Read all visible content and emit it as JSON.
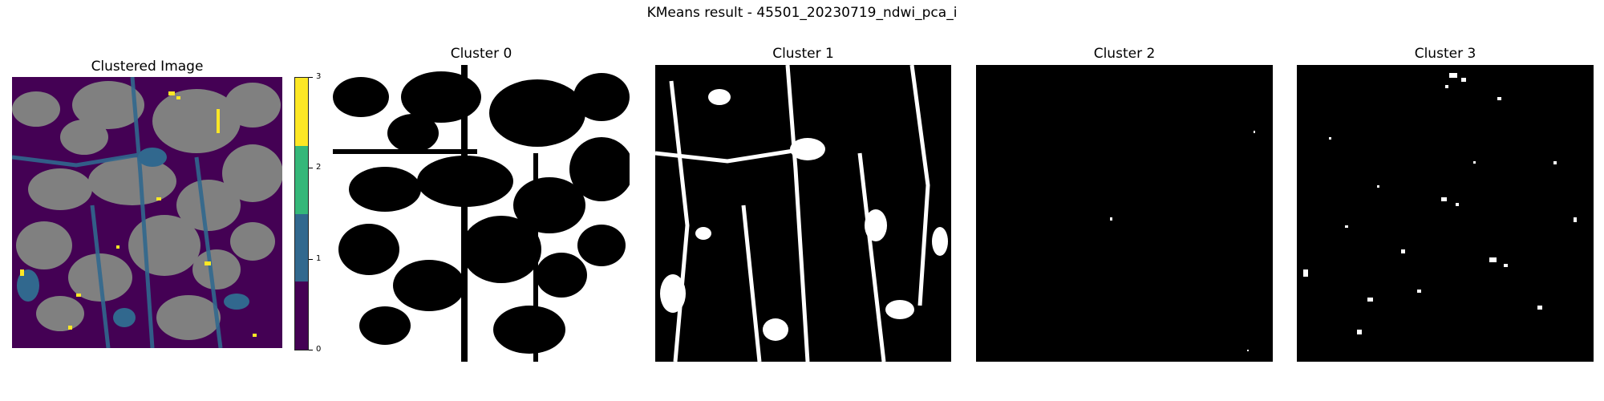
{
  "figure": {
    "suptitle": "KMeans result - 45501_20230719_ndwi_pca_i"
  },
  "panels": {
    "clustered": {
      "title": "Clustered Image"
    },
    "cluster0": {
      "title": "Cluster 0"
    },
    "cluster1": {
      "title": "Cluster 1"
    },
    "cluster2": {
      "title": "Cluster 2"
    },
    "cluster3": {
      "title": "Cluster 3"
    }
  },
  "colorbar": {
    "ticks": [
      "0",
      "1",
      "2",
      "3"
    ],
    "colors": [
      "#440154",
      "#31688e",
      "#35b779",
      "#fde725"
    ]
  },
  "colors": {
    "cloud_gray": "#808080",
    "mask_white": "#ffffff",
    "mask_black": "#000000"
  }
}
